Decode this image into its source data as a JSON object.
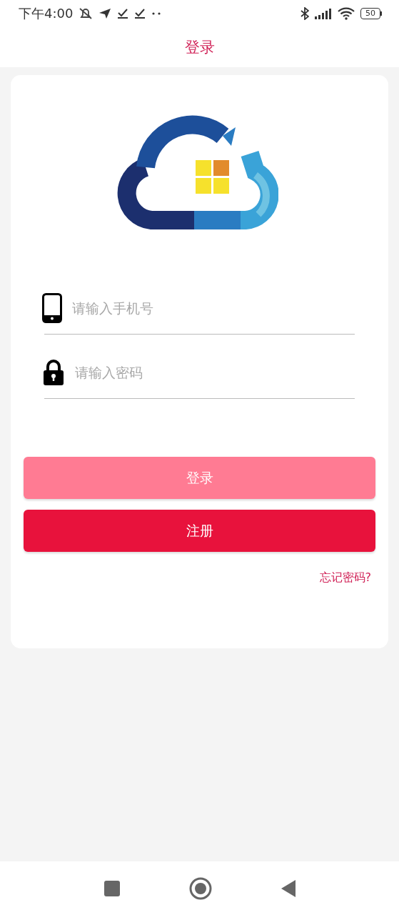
{
  "status_bar": {
    "time": "下午4:00",
    "battery": "50"
  },
  "header": {
    "title": "登录"
  },
  "form": {
    "fields": [
      {
        "kind": "phone",
        "placeholder": "请输入手机号"
      },
      {
        "kind": "password",
        "placeholder": "请输入密码"
      }
    ],
    "buttons": [
      {
        "label": "登录",
        "disabled": true
      },
      {
        "label": "注册",
        "disabled": false
      }
    ],
    "forgot_link": "忘记密码?"
  }
}
